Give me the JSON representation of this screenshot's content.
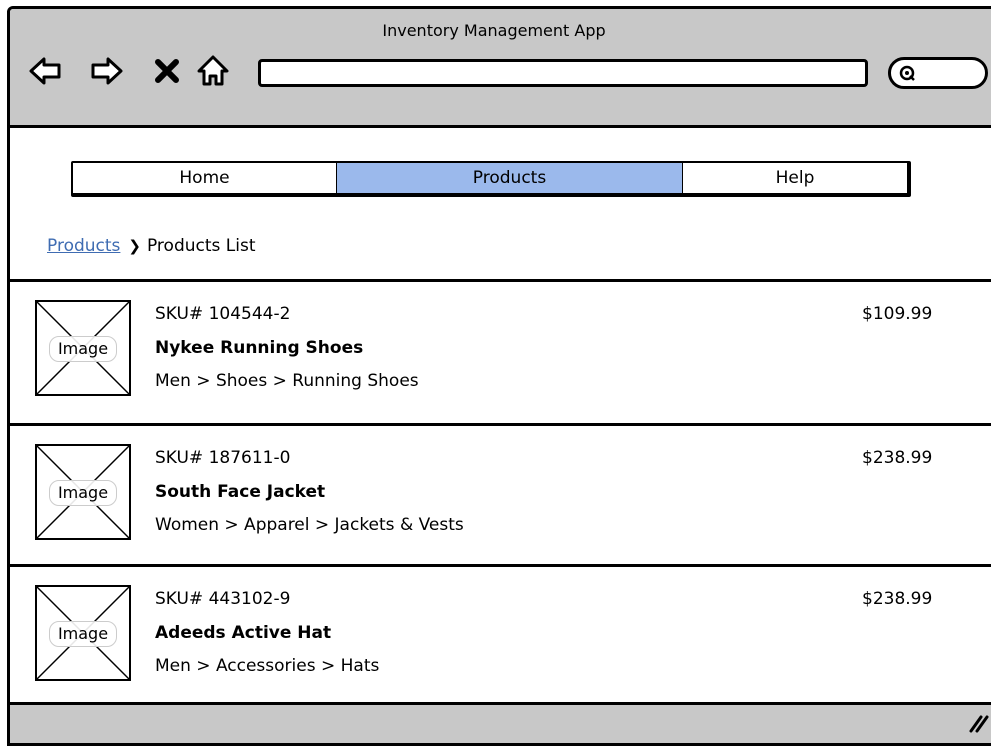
{
  "window": {
    "title": "Inventory Management App"
  },
  "toolbar": {
    "back_icon": "back-arrow-icon",
    "forward_icon": "forward-arrow-icon",
    "stop_icon": "close-icon",
    "home_icon": "home-icon",
    "url_value": "",
    "search_icon": "search-icon"
  },
  "nav": {
    "tabs": [
      {
        "label": "Home",
        "selected": false
      },
      {
        "label": "Products",
        "selected": true
      },
      {
        "label": "Help",
        "selected": false
      }
    ],
    "selected_color": "#9bb9ec"
  },
  "breadcrumb": {
    "link": "Products",
    "current": "Products List"
  },
  "products": [
    {
      "image_label": "Image",
      "sku": "SKU# 104544-2",
      "name": "Nykee Running Shoes",
      "category": "Men > Shoes > Running Shoes",
      "price": "$109.99"
    },
    {
      "image_label": "Image",
      "sku": "SKU# 187611-0",
      "name": "South Face Jacket",
      "category": "Women > Apparel > Jackets & Vests",
      "price": "$238.99"
    },
    {
      "image_label": "Image",
      "sku": "SKU# 443102-9",
      "name": "Adeeds Active Hat",
      "category": "Men > Accessories > Hats",
      "price": "$238.99"
    }
  ],
  "colors": {
    "chrome": "#c8c8c8",
    "link": "#3f6cb2"
  }
}
